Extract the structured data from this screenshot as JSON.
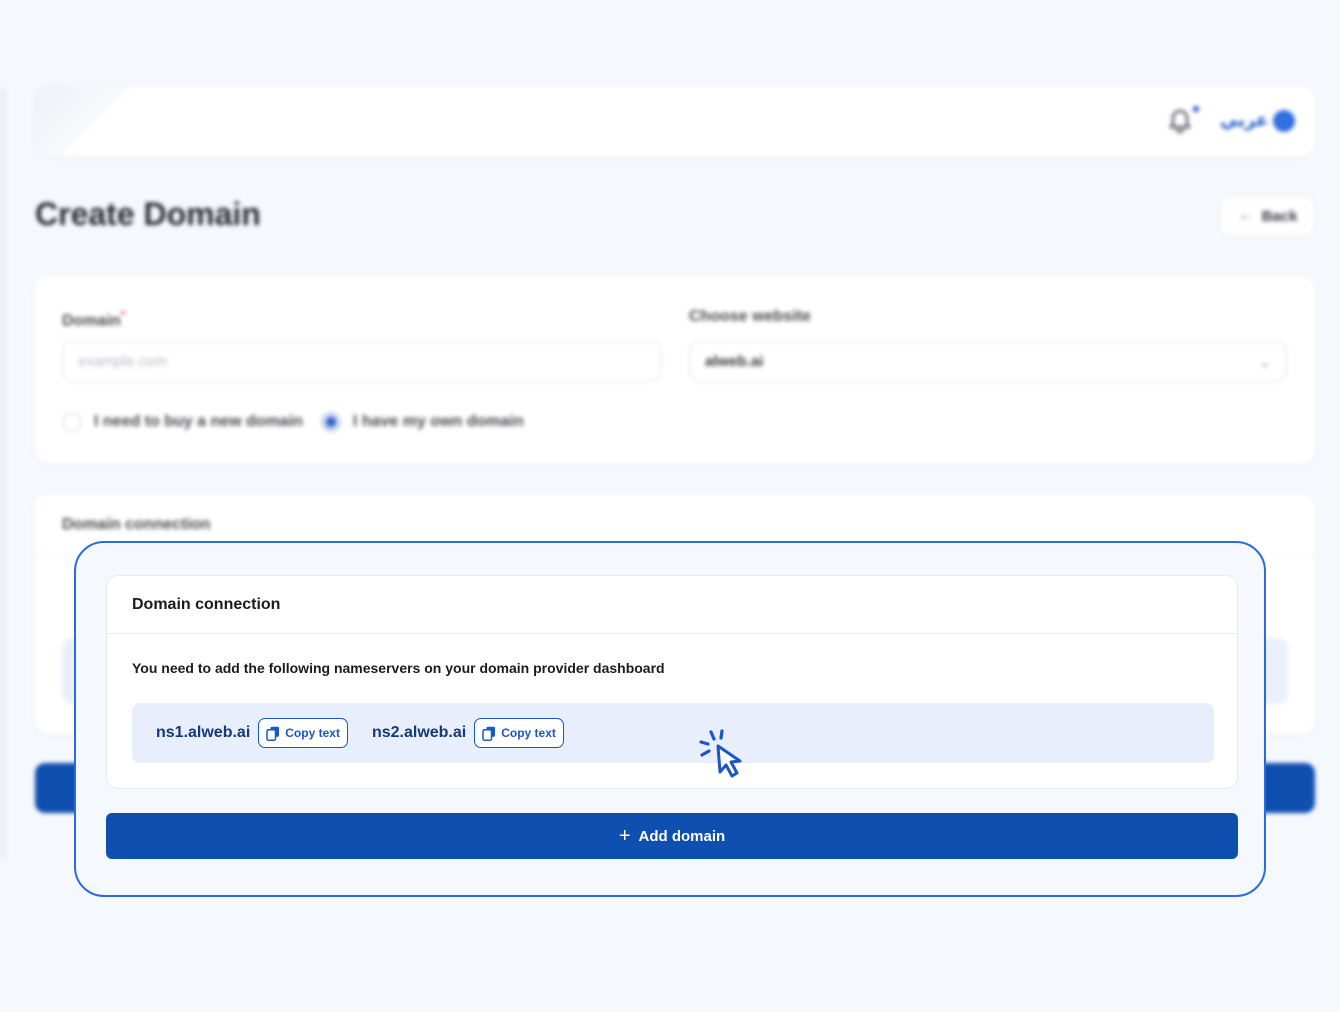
{
  "header": {
    "language_label": "عربي",
    "bell_icon": "bell-icon",
    "globe_icon": "globe-icon"
  },
  "page": {
    "title": "Create Domain",
    "back_label": "Back"
  },
  "form": {
    "domain_label": "Domain",
    "domain_required_mark": "*",
    "domain_placeholder": "example.com",
    "website_label": "Choose website",
    "website_value": "alweb.ai",
    "radio_buy_label": "I need to buy a new domain",
    "radio_own_label": "I have my own domain",
    "selected_option": "own"
  },
  "connection": {
    "title": "Domain connection",
    "description": "You need to add the following nameservers on your domain provider dashboard",
    "nameservers": [
      {
        "host": "ns1.alweb.ai",
        "copy_label": "Copy text"
      },
      {
        "host": "ns2.alweb.ai",
        "copy_label": "Copy text"
      }
    ]
  },
  "actions": {
    "add_domain_label": "Add domain"
  },
  "colors": {
    "primary": "#0f4fb0",
    "accent": "#1a56c7",
    "frame_border": "#2a6be0",
    "strip_bg": "#e8eefb",
    "page_bg": "#f5f8fd"
  }
}
